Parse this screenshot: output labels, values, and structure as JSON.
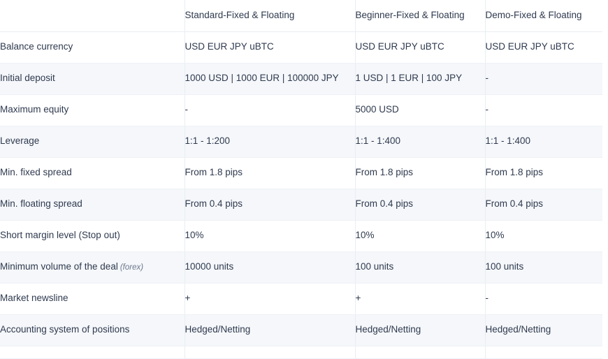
{
  "table": {
    "columns": [
      {
        "key": "label",
        "header": ""
      },
      {
        "key": "standard",
        "header": "Standard-Fixed & Floating"
      },
      {
        "key": "beginner",
        "header": "Beginner-Fixed & Floating"
      },
      {
        "key": "demo",
        "header": "Demo-Fixed & Floating"
      }
    ],
    "rows": [
      {
        "label": "Balance currency",
        "standard": "USD EUR JPY uBTC",
        "beginner": "USD EUR JPY uBTC",
        "demo": "USD EUR JPY uBTC"
      },
      {
        "label": "Initial deposit",
        "standard": "1000 USD | 1000 EUR | 100000 JPY",
        "beginner": "1 USD | 1 EUR | 100 JPY",
        "demo": "-"
      },
      {
        "label": "Maximum equity",
        "standard": "-",
        "beginner": "5000 USD",
        "demo": "-"
      },
      {
        "label": "Leverage",
        "standard": "1:1 - 1:200",
        "beginner": "1:1 - 1:400",
        "demo": "1:1 - 1:400"
      },
      {
        "label": "Min. fixed spread",
        "standard": "From 1.8 pips",
        "beginner": "From 1.8 pips",
        "demo": "From 1.8 pips"
      },
      {
        "label": "Min. floating spread",
        "standard": "From 0.4 pips",
        "beginner": "From 0.4 pips",
        "demo": "From 0.4 pips"
      },
      {
        "label": "Short margin level (Stop out)",
        "standard": "10%",
        "beginner": "10%",
        "demo": "10%"
      },
      {
        "label": "Minimum volume of the deal",
        "label_note": "(forex)",
        "standard": "10000 units",
        "beginner": "100 units",
        "demo": "100 units"
      },
      {
        "label": "Market newsline",
        "standard": "+",
        "beginner": "+",
        "demo": "-"
      },
      {
        "label": "Accounting system of positions",
        "standard": "Hedged/Netting",
        "beginner": "Hedged/Netting",
        "demo": "Hedged/Netting"
      }
    ]
  },
  "colors": {
    "header_text": "#28334d",
    "body_text": "#2f3a4f",
    "stripe": "#f5f7fa",
    "rule": "#eef1f6",
    "divider": "#e9edf3",
    "note_text": "#6b778d"
  }
}
